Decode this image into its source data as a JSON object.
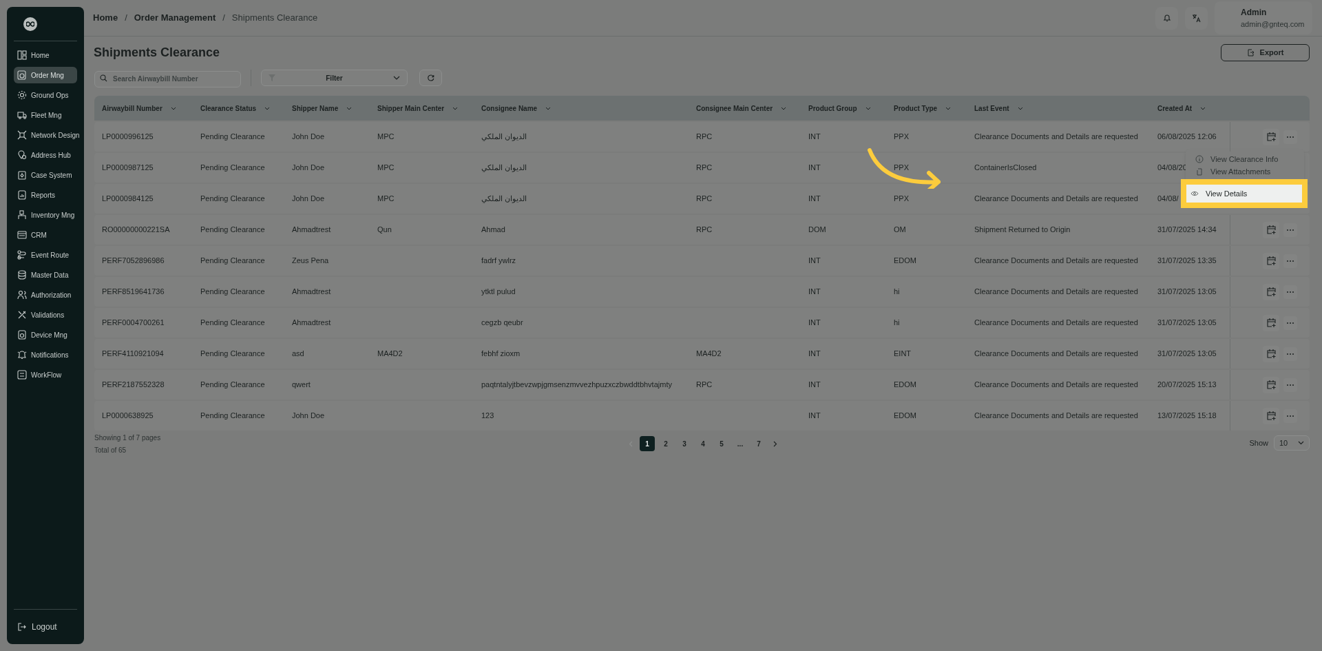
{
  "sidebar": {
    "items": [
      {
        "label": "Home",
        "selected": false
      },
      {
        "label": "Order Mng",
        "selected": true
      },
      {
        "label": "Ground Ops",
        "selected": false
      },
      {
        "label": "Fleet Mng",
        "selected": false
      },
      {
        "label": "Network Design",
        "selected": false
      },
      {
        "label": "Address Hub",
        "selected": false
      },
      {
        "label": "Case System",
        "selected": false
      },
      {
        "label": "Reports",
        "selected": false
      },
      {
        "label": "Inventory Mng",
        "selected": false
      },
      {
        "label": "CRM",
        "selected": false
      },
      {
        "label": "Event Route",
        "selected": false
      },
      {
        "label": "Master Data",
        "selected": false
      },
      {
        "label": "Authorization",
        "selected": false
      },
      {
        "label": "Validations",
        "selected": false
      },
      {
        "label": "Device Mng",
        "selected": false
      },
      {
        "label": "Notifications",
        "selected": false
      },
      {
        "label": "WorkFlow",
        "selected": false
      }
    ],
    "logout": "Logout"
  },
  "breadcrumb": [
    "Home",
    "Order Management",
    "Shipments Clearance"
  ],
  "separator": "/",
  "user": {
    "name": "Admin",
    "email": "admin@gnteq.com"
  },
  "page_title": "Shipments Clearance",
  "export_button": "Export",
  "search": {
    "placeholder": "Search Airwaybill Number"
  },
  "filter": {
    "label": "Filter"
  },
  "table": {
    "columns": [
      "Airwaybill Number",
      "Clearance Status",
      "Shipper Name",
      "Shipper Main Center",
      "Consignee Name",
      "Consignee Main Center",
      "Product Group",
      "Product Type",
      "Last Event",
      "Created At"
    ],
    "rows": [
      {
        "cells": [
          "LP0000996125",
          "Pending Clearance",
          "John Doe",
          "MPC",
          "الديوان الملكي",
          "RPC",
          "INT",
          "PPX",
          "Clearance Documents and Details are requested",
          "06/08/2025 12:06"
        ],
        "actions": true
      },
      {
        "cells": [
          "LP0000987125",
          "Pending Clearance",
          "John Doe",
          "MPC",
          "الديوان الملكي",
          "RPC",
          "INT",
          "PPX",
          "ContainerIsClosed",
          "04/08/20"
        ],
        "actions": false
      },
      {
        "cells": [
          "LP0000984125",
          "Pending Clearance",
          "John Doe",
          "MPC",
          "الديوان الملكي",
          "RPC",
          "INT",
          "PPX",
          "Clearance Documents and Details are requested",
          "04/08/"
        ],
        "actions": false
      },
      {
        "cells": [
          "RO00000000221SA",
          "Pending Clearance",
          "Ahmadtrest",
          "Qun",
          "Ahmad",
          "RPC",
          "DOM",
          "OM",
          "Shipment Returned to Origin",
          "31/07/2025 14:34"
        ],
        "actions": true
      },
      {
        "cells": [
          "PERF7052896986",
          "Pending Clearance",
          "Zeus Pena",
          "",
          "fadrf ywlrz",
          "",
          "INT",
          "EDOM",
          "Clearance Documents and Details are requested",
          "31/07/2025 13:35"
        ],
        "actions": true
      },
      {
        "cells": [
          "PERF8519641736",
          "Pending Clearance",
          "Ahmadtrest",
          "",
          "ytktl pulud",
          "",
          "INT",
          "hi",
          "Clearance Documents and Details are requested",
          "31/07/2025 13:05"
        ],
        "actions": true
      },
      {
        "cells": [
          "PERF0004700261",
          "Pending Clearance",
          "Ahmadtrest",
          "",
          "cegzb qeubr",
          "",
          "INT",
          "hi",
          "Clearance Documents and Details are requested",
          "31/07/2025 13:05"
        ],
        "actions": true
      },
      {
        "cells": [
          "PERF4110921094",
          "Pending Clearance",
          "asd",
          "MA4D2",
          "febhf zioxm",
          "MA4D2",
          "INT",
          "EINT",
          "Clearance Documents and Details are requested",
          "31/07/2025 13:05"
        ],
        "actions": true
      },
      {
        "cells": [
          "PERF2187552328",
          "Pending Clearance",
          "qwert",
          "",
          "paqtntalyjtbevzwpjgmsenzmvvezhpuzxczbwddtbhvtajmty",
          "RPC",
          "INT",
          "EDOM",
          "Clearance Documents and Details are requested",
          "20/07/2025 15:13"
        ],
        "actions": true
      },
      {
        "cells": [
          "LP0000638925",
          "Pending Clearance",
          "John Doe",
          "",
          "123",
          "",
          "INT",
          "EDOM",
          "Clearance Documents and Details are requested",
          "13/07/2025 15:18"
        ],
        "actions": true
      }
    ]
  },
  "row_menu": {
    "items": [
      {
        "label": "View Clearance Info",
        "highlighted": false
      },
      {
        "label": "View Attachments",
        "highlighted": false
      },
      {
        "label": "View Details",
        "highlighted": true
      }
    ]
  },
  "footer": {
    "showing": "Showing 1 of 7 pages",
    "total": "Total of 65",
    "pages": [
      {
        "label": "1",
        "selected": true
      },
      {
        "label": "2",
        "selected": false
      },
      {
        "label": "3",
        "selected": false
      },
      {
        "label": "4",
        "selected": false
      },
      {
        "label": "5",
        "selected": false
      },
      {
        "label": "...",
        "selected": false
      },
      {
        "label": "7",
        "selected": false
      }
    ],
    "show_label": "Show",
    "page_size": "10"
  }
}
